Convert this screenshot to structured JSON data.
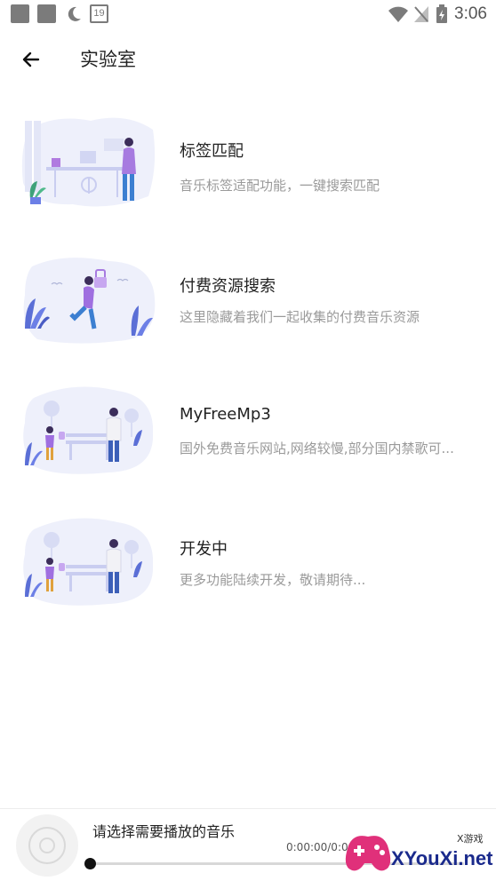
{
  "status_bar": {
    "time": "3:06",
    "calendar_day": "19"
  },
  "toolbar": {
    "title": "实验室"
  },
  "lab_items": [
    {
      "name": "标签匹配",
      "description": "音乐标签适配功能，一键搜索匹配",
      "illustration": "office-desk-woman"
    },
    {
      "name": "付费资源搜索",
      "description": "这里隐藏着我们一起收集的付费音乐资源",
      "illustration": "running-woman-plants"
    },
    {
      "name": "MyFreeMp3",
      "description": "国外免费音乐网站,网络较慢,部分国内禁歌可...",
      "illustration": "park-bench-people"
    },
    {
      "name": "开发中",
      "description": "更多功能陆续开发，敬请期待...",
      "illustration": "park-bench-people"
    }
  ],
  "player": {
    "hint": "请选择需要播放的音乐",
    "time": "0:00:00/0:00:00",
    "progress": 0
  },
  "watermark": {
    "text": "XYouXi.net",
    "sub": "X游戏"
  },
  "colors": {
    "accent_purple": "#8e6bdb",
    "illustration_bg": "#eef0fb",
    "plant_blue": "#5b6fd6"
  }
}
